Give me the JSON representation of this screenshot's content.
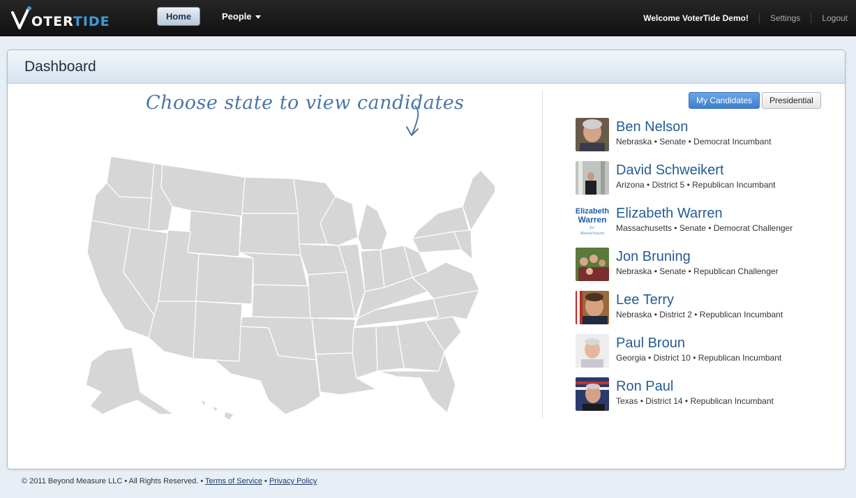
{
  "header": {
    "logo_v": "V",
    "logo_oter": "OTER",
    "logo_tide": "TIDE",
    "nav": {
      "home": "Home",
      "people": "People"
    },
    "welcome": "Welcome VoterTide Demo!",
    "settings": "Settings",
    "logout": "Logout"
  },
  "panel": {
    "title": "Dashboard",
    "prompt": "Choose state to view candidates",
    "tabs": {
      "my_candidates": "My Candidates",
      "presidential": "Presidential"
    }
  },
  "candidates": [
    {
      "name": "Ben Nelson",
      "state": "Nebraska",
      "office": "Senate",
      "status": "Democrat Incumbant",
      "photo": "portrait-grey-hair"
    },
    {
      "name": "David Schweikert",
      "state": "Arizona",
      "office": "District 5",
      "status": "Republican Incumbant",
      "photo": "portrait-hallway"
    },
    {
      "name": "Elizabeth Warren",
      "state": "Massachusetts",
      "office": "Senate",
      "status": "Democrat Challenger",
      "photo": "campaign-logo"
    },
    {
      "name": "Jon Bruning",
      "state": "Nebraska",
      "office": "Senate",
      "status": "Republican Challenger",
      "photo": "family-photo"
    },
    {
      "name": "Lee Terry",
      "state": "Nebraska",
      "office": "District 2",
      "status": "Republican Incumbant",
      "photo": "portrait-flag"
    },
    {
      "name": "Paul Broun",
      "state": "Georgia",
      "office": "District 10",
      "status": "Republican Incumbant",
      "photo": "portrait-light"
    },
    {
      "name": "Ron Paul",
      "state": "Texas",
      "office": "District 14",
      "status": "Republican Incumbant",
      "photo": "portrait-flag-2"
    }
  ],
  "logo_campaign": {
    "line1": "Elizabeth",
    "line2": "Warren",
    "line3": "for",
    "line4": "Massachusetts"
  },
  "footer": {
    "copyright": "© 2011 Beyond Measure LLC • All Rights Reserved. •",
    "terms": "Terms of Service",
    "sep": "•",
    "privacy": "Privacy Policy"
  },
  "colors": {
    "accent": "#3d7fcf",
    "name_link": "#245c94",
    "map_fill": "#d6d6d6"
  }
}
